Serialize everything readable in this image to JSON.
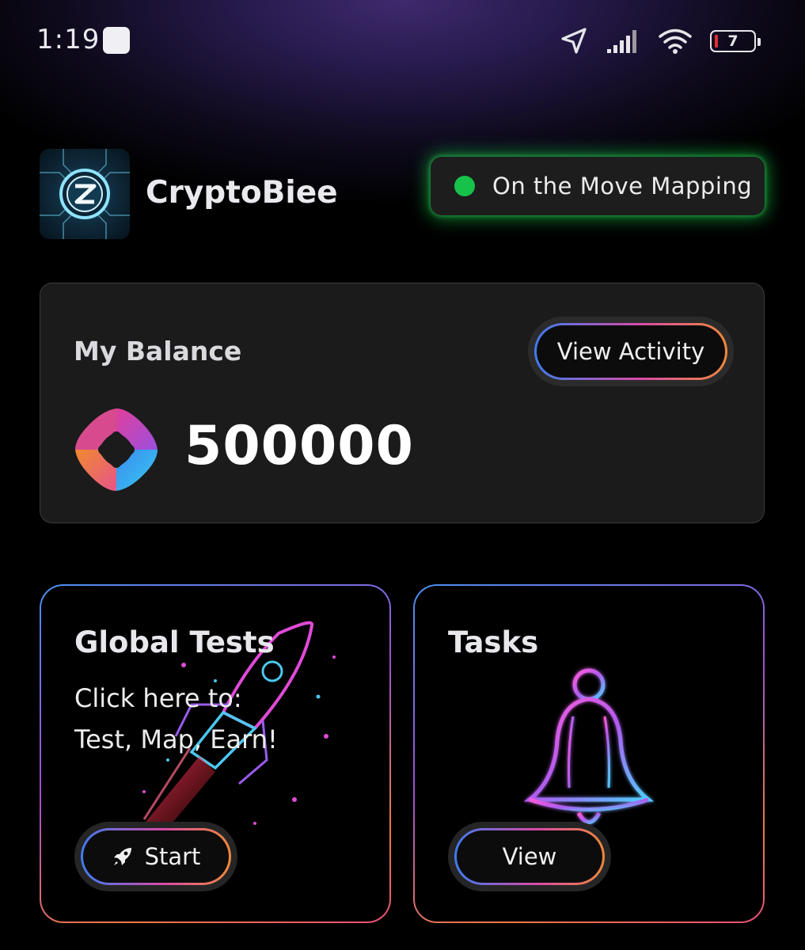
{
  "status_bar": {
    "time": "1:19",
    "battery_level": "7",
    "icons": [
      "notification-square-icon",
      "location-arrow-icon",
      "cell-signal-icon",
      "wifi-icon",
      "battery-icon"
    ]
  },
  "header": {
    "app_name": "CryptoBiee",
    "mode_label": "On the Move Mapping",
    "mode_status_color": "#17c24a"
  },
  "balance": {
    "title": "My Balance",
    "activity_button": "View Activity",
    "value": "500000",
    "coin_icon": "coin-logo-icon"
  },
  "cards": {
    "global_tests": {
      "title": "Global Tests",
      "line1": "Click here to:",
      "line2": "Test, Map, Earn!",
      "button": "Start",
      "art": "neon-rocket-icon"
    },
    "tasks": {
      "title": "Tasks",
      "button": "View",
      "art": "neon-bell-icon"
    }
  },
  "colors": {
    "background": "#000000",
    "card_bg": "#1b1b1b",
    "gradient_start": "#3f7cf0",
    "gradient_mid": "#d94aa8",
    "gradient_end": "#f0893a"
  }
}
